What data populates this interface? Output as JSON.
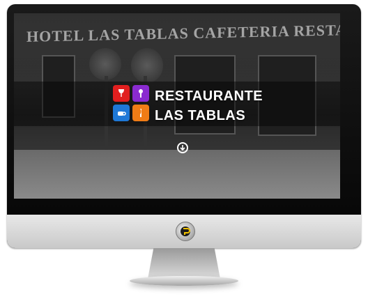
{
  "screen": {
    "sign_text": "HOTEL LAS TABLAS CAFETERIA RESTAURANTE",
    "title_line1": "RESTAURANTE",
    "title_line2": "LAS TABLAS"
  },
  "logo_tiles": [
    {
      "icon": "wine-glass-icon",
      "color": "#e11f1f"
    },
    {
      "icon": "cutlery-icon",
      "color": "#8a2bd0"
    },
    {
      "icon": "coffee-cup-icon",
      "color": "#1e78d7"
    },
    {
      "icon": "knife-icon",
      "color": "#f07c16"
    }
  ],
  "scroll_icon": "arrow-down-circle-icon",
  "brand_icon": "brand-logo-icon"
}
